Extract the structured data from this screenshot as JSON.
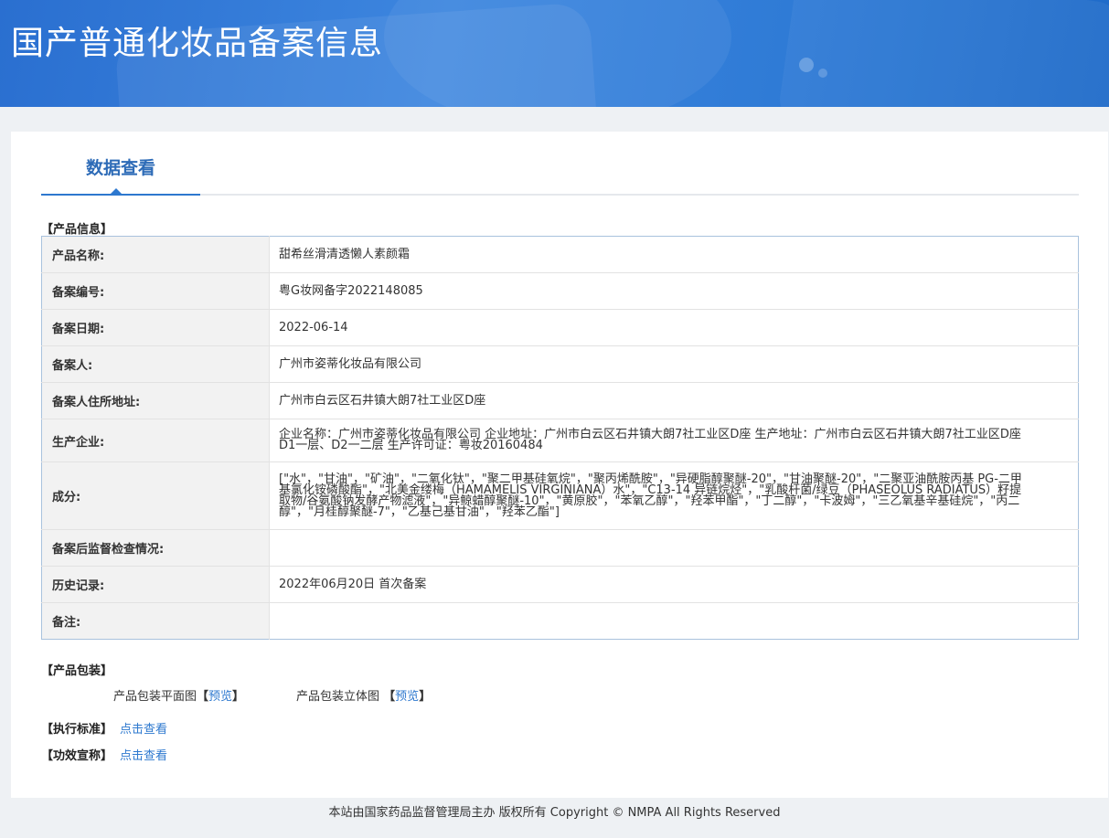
{
  "header": {
    "title": "国产普通化妆品备案信息"
  },
  "tabs": {
    "active": "数据查看"
  },
  "product_info": {
    "section_title": "【产品信息】",
    "rows": [
      {
        "label": "产品名称:",
        "value": "甜希丝滑清透懒人素颜霜"
      },
      {
        "label": "备案编号:",
        "value": "粤G妆网备字2022148085"
      },
      {
        "label": "备案日期:",
        "value": "2022-06-14"
      },
      {
        "label": "备案人:",
        "value": "广州市姿蒂化妆品有限公司"
      },
      {
        "label": "备案人住所地址:",
        "value": "广州市白云区石井镇大朗7社工业区D座"
      },
      {
        "label": "生产企业:",
        "value": "企业名称：广州市姿蒂化妆品有限公司 企业地址：广州市白云区石井镇大朗7社工业区D座 生产地址：广州市白云区石井镇大朗7社工业区D座D1一层、D2一二层 生产许可证：粤妆20160484"
      },
      {
        "label": "成分:",
        "value": "[\"水\"，\"甘油\"，\"矿油\"，\"二氧化钛\"，\"聚二甲基硅氧烷\"，\"聚丙烯酰胺\"，\"异硬脂醇聚醚-20\"，\"甘油聚醚-20\"，\"二聚亚油酰胺丙基 PG-二甲基氯化铵磷酸酯\"，\"北美金缕梅（HAMAMELIS VIRGINIANA）水\"，\"C13-14 异链烷烃\"，\"乳酸杆菌/绿豆（PHASEOLUS RADIATUS）籽提取物/谷氨酸钠发酵产物滤液\"，\"异鲸蜡醇聚醚-10\"，\"黄原胶\"，\"苯氧乙醇\"，\"羟苯甲酯\"，\"丁二醇\"，\"卡波姆\"，\"三乙氧基辛基硅烷\"，\"丙二醇\"，\"月桂醇聚醚-7\"，\"乙基己基甘油\"，\"羟苯乙酯\"]"
      },
      {
        "label": "备案后监督检查情况:",
        "value": ""
      },
      {
        "label": "历史记录:",
        "value": "2022年06月20日 首次备案"
      },
      {
        "label": "备注:",
        "value": ""
      }
    ]
  },
  "packaging": {
    "section_title": "【产品包装】",
    "flat_label": "产品包装平面图",
    "flat_link": "预览",
    "stereo_label": "产品包装立体图",
    "stereo_link": "预览"
  },
  "standard": {
    "label": "【执行标准】",
    "link": "点击查看"
  },
  "efficacy": {
    "label": "【功效宣称】",
    "link": "点击查看"
  },
  "footer": {
    "text": "本站由国家药品监督管理局主办 版权所有 Copyright © NMPA All Rights Reserved"
  }
}
